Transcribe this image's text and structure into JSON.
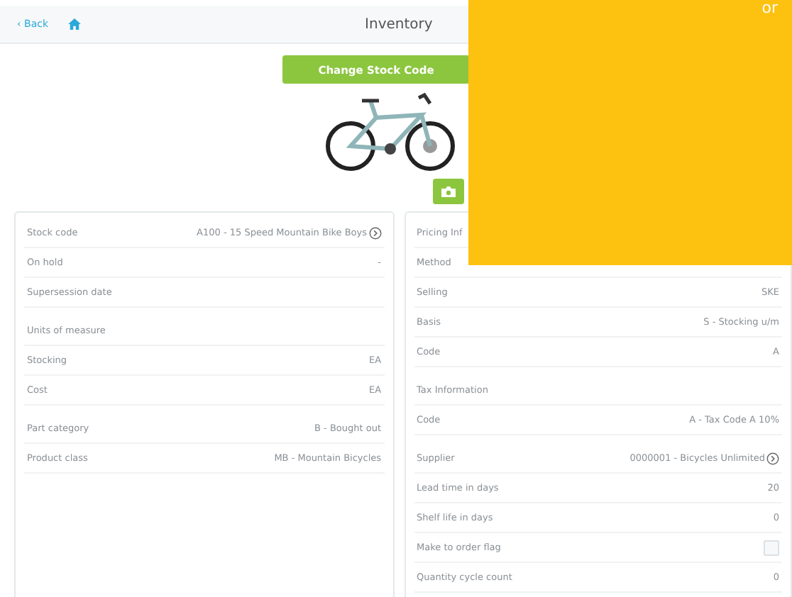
{
  "nav": {
    "back": "‹ Back",
    "title": "Inventory"
  },
  "change_button": "Change Stock Code",
  "left_card": [
    [
      {
        "kind": "link",
        "label": "Stock code",
        "value": "A100 - 15 Speed Mountain Bike Boys"
      },
      {
        "kind": "field",
        "label": "On hold",
        "value": "-"
      },
      {
        "kind": "field",
        "label": "Supersession date"
      }
    ],
    [
      {
        "kind": "header",
        "label": "Units of measure"
      },
      {
        "kind": "field",
        "label": "Stocking",
        "value": "EA"
      },
      {
        "kind": "field",
        "label": "Cost",
        "value": "EA"
      }
    ],
    [
      {
        "kind": "field",
        "label": "Part category",
        "value": "B - Bought out"
      },
      {
        "kind": "field",
        "label": "Product class",
        "value": "MB - Mountain Bicycles"
      }
    ]
  ],
  "right_card": [
    [
      {
        "kind": "header",
        "label": "Pricing Inf"
      },
      {
        "kind": "field",
        "label": "Method"
      },
      {
        "kind": "field",
        "label": "Selling",
        "value": "SKE"
      },
      {
        "kind": "field",
        "label": "Basis",
        "value": "S - Stocking u/m"
      },
      {
        "kind": "field",
        "label": "Code",
        "value": "A"
      }
    ],
    [
      {
        "kind": "header",
        "label": "Tax Information"
      },
      {
        "kind": "field",
        "label": "Code",
        "value": "A - Tax Code A 10%"
      }
    ],
    [
      {
        "kind": "link",
        "label": "Supplier",
        "value": "0000001 - Bicycles Unlimited"
      },
      {
        "kind": "field",
        "label": "Lead time in days",
        "value": "20"
      },
      {
        "kind": "field",
        "label": "Shelf life in days",
        "value": "0"
      },
      {
        "kind": "checkbox",
        "label": "Make to order flag",
        "checked": false
      },
      {
        "kind": "field",
        "label": "Quantity cycle count",
        "value": "0"
      }
    ]
  ],
  "overlay": {
    "text": "or"
  }
}
